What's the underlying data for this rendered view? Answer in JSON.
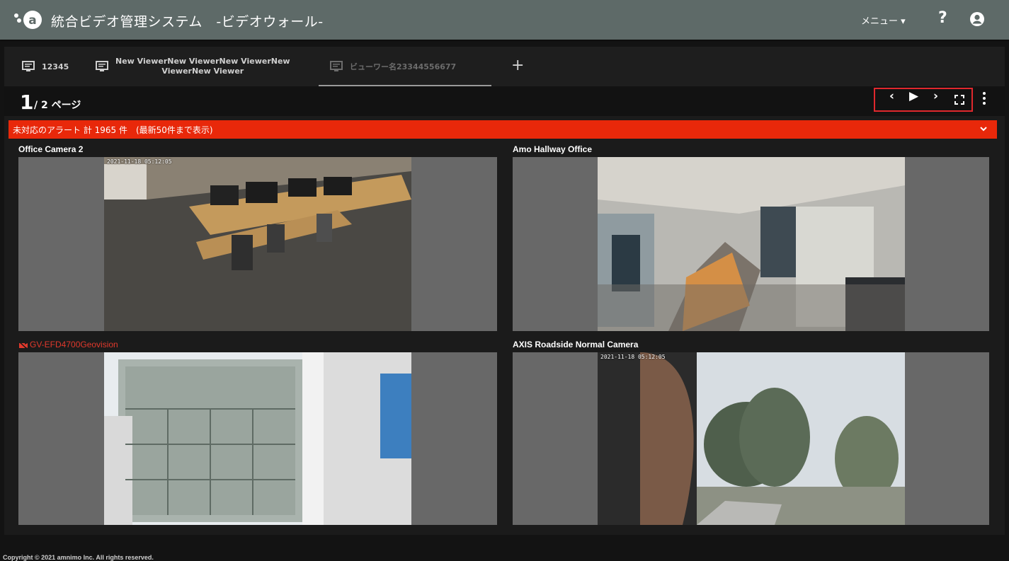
{
  "header": {
    "title": "統合ビデオ管理システム　-ビデオウォール-",
    "menu_label": "メニュー ▾",
    "help_label": "?",
    "icons": [
      "amnimo-logo",
      "account-icon"
    ]
  },
  "tabs": [
    {
      "label": "12345",
      "active": false
    },
    {
      "label_line1": "New ViewerNew ViewerNew ViewerNew",
      "label_line2": "ViewerNew Viewer",
      "active": false
    },
    {
      "label": "ビューワー名23344556677",
      "active": true
    }
  ],
  "tab_add_label": "+",
  "pagination": {
    "current": "1",
    "total_label": "/ 2 ページ"
  },
  "controls": {
    "prev": "‹",
    "play": "▶",
    "next": "›",
    "fullscreen": "⛶",
    "accent": "#e0282d"
  },
  "alert": {
    "text": "未対応のアラート  計 1965 件　(最新50件まで表示)",
    "color": "#e8280a"
  },
  "cameras": [
    {
      "name": "Office Camera 2",
      "timestamp": "2021-11-18 05:12:05",
      "status": "online"
    },
    {
      "name": "Amo Hallway Office",
      "timestamp": "",
      "status": "online"
    },
    {
      "name": "GV-EFD4700Geovision",
      "timestamp": "",
      "status": "offline"
    },
    {
      "name": "AXIS Roadside Normal Camera",
      "timestamp": "2021-11-18 05:12:05",
      "status": "online"
    }
  ],
  "footer": {
    "copyright": "Copyright © 2021 amnimo Inc. All rights reserved."
  }
}
